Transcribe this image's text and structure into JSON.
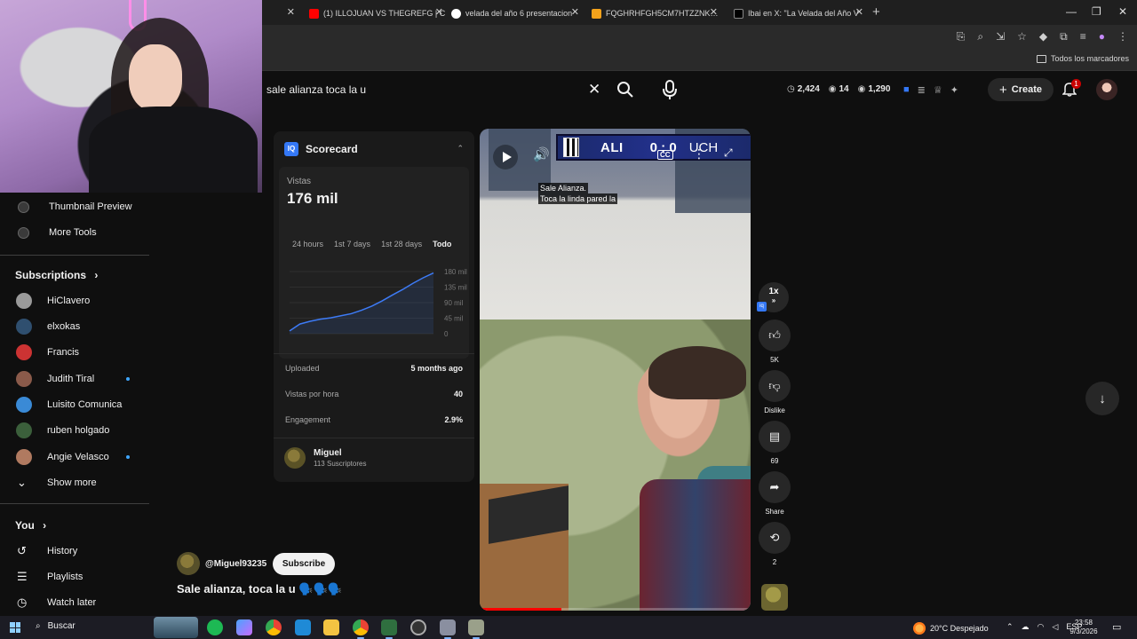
{
  "browser": {
    "tabs": [
      {
        "title": "(1) ILLOJUAN VS THEGREFG | C",
        "favicon": "youtube-icon",
        "color": "#ff0000"
      },
      {
        "title": "velada del año 6 presentacion",
        "favicon": "google-icon",
        "color": "#ffffff"
      },
      {
        "title": "FQGHRHFGH5CM7HTZZNKSBK",
        "favicon": "file-icon",
        "color": "#f4a21b"
      },
      {
        "title": "Ibai en X: \"La Velada del Año V",
        "favicon": "x-icon",
        "color": "#ffffff"
      }
    ],
    "bookmarks_all": "Todos los marcadores"
  },
  "header": {
    "search_query": "sale alianza toca la u",
    "stats": {
      "views": "2,424",
      "likes": "14",
      "comments": "1,290"
    },
    "create_label": "Create",
    "notification_count": "1"
  },
  "sidebar": {
    "tools": [
      {
        "label": "Thumbnail Preview",
        "icon": "tool-icon"
      },
      {
        "label": "More Tools",
        "icon": "tool-icon"
      }
    ],
    "subscriptions_title": "Subscriptions",
    "subscriptions": [
      {
        "label": "HiClavero",
        "color": "#9a9a9a",
        "dot": false
      },
      {
        "label": "elxokas",
        "color": "#2f4f6f",
        "dot": false
      },
      {
        "label": "Francis",
        "color": "#c33",
        "dot": false
      },
      {
        "label": "Judith Tiral",
        "color": "#8a5a4a",
        "dot": true
      },
      {
        "label": "Luisito Comunica",
        "color": "#3a8ad6",
        "dot": false
      },
      {
        "label": "ruben holgado",
        "color": "#3b5f3b",
        "dot": false
      },
      {
        "label": "Angie Velasco",
        "color": "#b07a60",
        "dot": true
      }
    ],
    "show_more": "Show more",
    "you_title": "You",
    "you_items": [
      {
        "label": "History",
        "icon": "history-icon"
      },
      {
        "label": "Playlists",
        "icon": "playlists-icon"
      },
      {
        "label": "Watch later",
        "icon": "watch-later-icon"
      }
    ]
  },
  "scorecard": {
    "title": "Scorecard",
    "views_label": "Vistas",
    "views_value": "176 mil",
    "periods": [
      "24 hours",
      "1st 7 days",
      "1st 28 days",
      "Todo"
    ],
    "active_period": "Todo",
    "metrics": [
      {
        "label": "Uploaded",
        "value": "5 months ago"
      },
      {
        "label": "Vistas por hora",
        "value": "40"
      },
      {
        "label": "Engagement",
        "value": "2.9%"
      }
    ],
    "owner_name": "Miguel",
    "owner_subs": "113 Suscriptores",
    "chart_data": {
      "type": "line",
      "y_ticks": [
        "180 mil",
        "135 mil",
        "90 mil",
        "45 mil",
        "0"
      ],
      "ylim": [
        0,
        180000
      ],
      "values": [
        8000,
        28000,
        36000,
        42000,
        46000,
        52000,
        58000,
        68000,
        80000,
        95000,
        112000,
        128000,
        146000,
        162000,
        176000
      ],
      "color": "#3d7bf6"
    }
  },
  "video": {
    "channel_handle": "@Miguel93235",
    "subscribe_label": "Subscribe",
    "caption": "Sale alianza, toca la u 🗣️🗣️🗣️",
    "scoreboard_team1": "ALI",
    "scoreboard_score": "0 : 0",
    "scoreboard_team2": "UCH",
    "subtitle_line1": "Sale Alianza.",
    "subtitle_line2": "Toca la linda pared la",
    "cc_label": "CC",
    "progress": 0.3
  },
  "actions": {
    "speed": "1x",
    "like_count": "5K",
    "dislike_label": "Dislike",
    "comment_count": "69",
    "share_label": "Share",
    "remix_count": "2"
  },
  "taskbar": {
    "search_label": "Buscar",
    "weather": "20°C  Despejado",
    "lang": "ESP",
    "time": "23:58",
    "date": "9/3/2026"
  }
}
